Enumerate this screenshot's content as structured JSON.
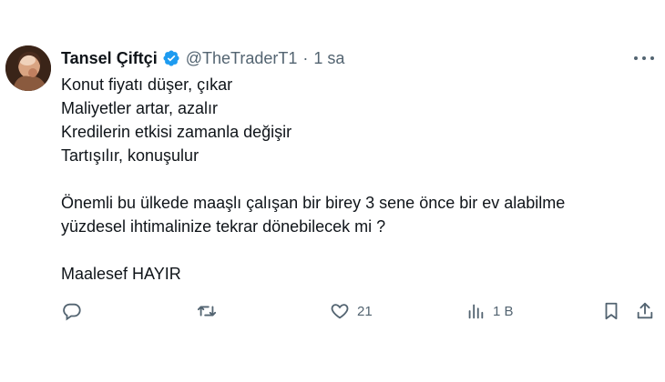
{
  "author": {
    "name": "Tansel Çiftçi",
    "handle": "@TheTraderT1",
    "separator": "·",
    "time": "1 sa"
  },
  "tweet": {
    "lines_block1": [
      "Konut fiyatı düşer, çıkar",
      "Maliyetler artar, azalır",
      "Kredilerin etkisi zamanla değişir",
      "Tartışılır, konuşulur"
    ],
    "lines_block2": [
      "Önemli bu ülkede maaşlı çalışan bir birey 3 sene önce bir ev alabilme",
      "yüzdesel ihtimalinize tekrar dönebilecek mi ?"
    ],
    "lines_block3": [
      "Maalesef HAYIR"
    ]
  },
  "actions": {
    "likes": "21",
    "views": "1 B"
  },
  "icons": {
    "verified": "verified-badge-icon",
    "more": "more-icon",
    "reply": "reply-icon",
    "retweet": "retweet-icon",
    "like": "heart-icon",
    "views": "views-icon",
    "bookmark": "bookmark-icon",
    "share": "share-icon"
  },
  "colors": {
    "verified_blue": "#1d9bf0",
    "text": "#0f1419",
    "muted": "#536471"
  }
}
